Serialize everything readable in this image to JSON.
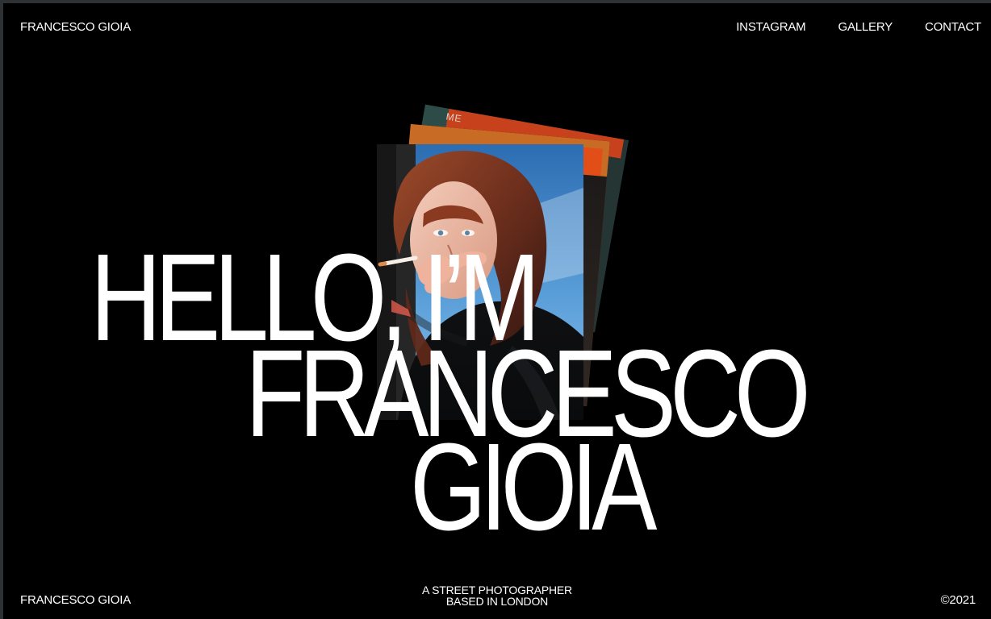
{
  "header": {
    "brand": "FRANCESCO GIOIA",
    "nav": {
      "instagram": "INSTAGRAM",
      "gallery": "GALLERY",
      "contact": "CONTACT"
    }
  },
  "hero": {
    "line1": "HELLO, I’M",
    "line2": "FRANCESCO",
    "line3": "GIOIA",
    "photo_back_text": "ME"
  },
  "footer": {
    "left": "FRANCESCO GIOIA",
    "center_line1": "A STREET PHOTOGRAPHER",
    "center_line2": "BASED IN LONDON",
    "right": "©2021"
  },
  "colors": {
    "background": "#000000",
    "window_border": "#2f3234",
    "text": "#ffffff"
  },
  "icons": {
    "photo_stack": "photo-stack-image",
    "portrait": "portrait-photo"
  }
}
